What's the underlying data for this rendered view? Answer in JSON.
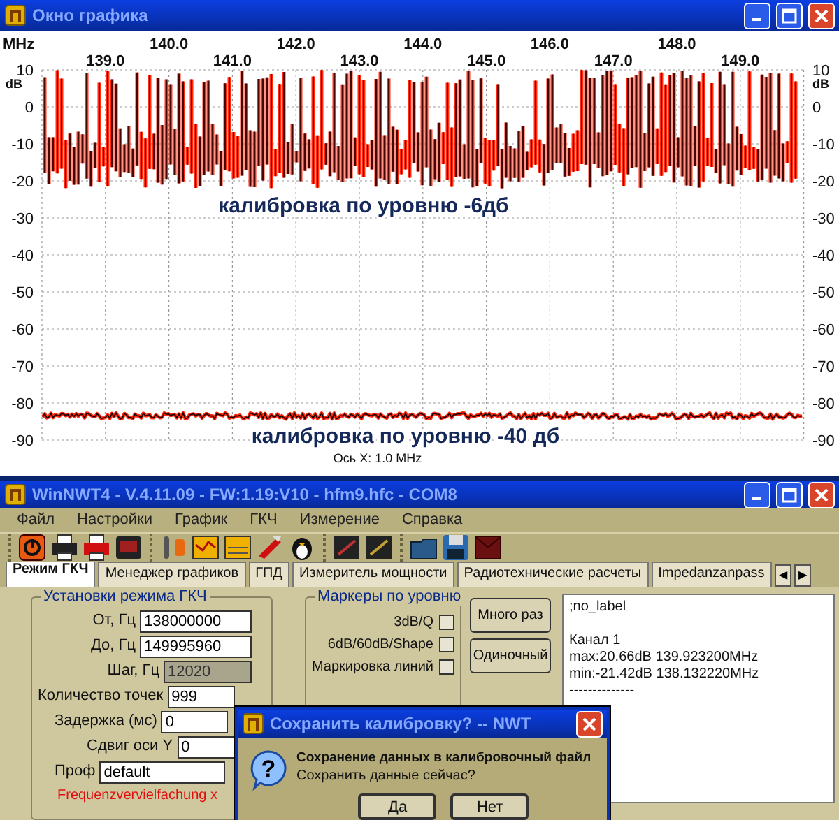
{
  "graph_window": {
    "title": "Окно графика",
    "x_axis": {
      "unit": "MHz",
      "upper_labels": [
        "140.0",
        "142.0",
        "144.0",
        "146.0",
        "148.0"
      ],
      "lower_labels": [
        "139.0",
        "141.0",
        "143.0",
        "145.0",
        "147.0",
        "149.0"
      ]
    },
    "y_axis_left": {
      "unit": "dB",
      "labels": [
        "10",
        "0",
        "-10",
        "-20",
        "-30",
        "-40",
        "-50",
        "-60",
        "-70",
        "-80",
        "-90"
      ]
    },
    "y_axis_right": {
      "unit": "dB",
      "labels": [
        "10",
        "0",
        "-10",
        "-20",
        "-30",
        "-40",
        "-50",
        "-60",
        "-70",
        "-80",
        "-90"
      ]
    },
    "annotations": [
      "калибровка по уровню -6дб",
      "калибровка по уровню -40 дб"
    ],
    "x_scale": "Ось X: 1.0 MHz"
  },
  "main_window": {
    "title": "WinNWT4 - V.4.11.09 - FW:1.19:V10 - hfm9.hfc - COM8",
    "menu": [
      "Файл",
      "Настройки",
      "График",
      "ГКЧ",
      "Измерение",
      "Справка"
    ],
    "tabs": [
      {
        "label": "Режим ГКЧ",
        "selected": true
      },
      {
        "label": "Менеджер графиков",
        "selected": false
      },
      {
        "label": "ГПД",
        "selected": false
      },
      {
        "label": "Измеритель мощности",
        "selected": false
      },
      {
        "label": "Радиотехнические расчеты",
        "selected": false
      },
      {
        "label": "Impedanzanpass",
        "selected": false
      }
    ],
    "tab_scroll_buttons": [
      "◀",
      "▶"
    ],
    "sweep_settings": {
      "title": "Установки режима ГКЧ",
      "fields": [
        {
          "label": "От, Гц",
          "value": "138000000",
          "disabled": false
        },
        {
          "label": "До, Гц",
          "value": "149995960",
          "disabled": false
        },
        {
          "label": "Шаг, Гц",
          "value": "12020",
          "disabled": true
        },
        {
          "label": "Количество точек",
          "value": "999",
          "disabled": false
        },
        {
          "label": "Задержка (мс)",
          "value": "0",
          "disabled": false
        },
        {
          "label": "Сдвиг оси Y",
          "value": "0",
          "disabled": false
        }
      ],
      "profile": {
        "label": "Проф",
        "value": "default"
      },
      "warning": "Frequenzvervielfachung x"
    },
    "markers": {
      "title": "Маркеры по уровню",
      "items": [
        {
          "label": "3dB/Q",
          "checked": false
        },
        {
          "label": "6dB/60dB/Shape",
          "checked": false
        },
        {
          "label": "Маркировка линий",
          "checked": false
        }
      ]
    },
    "buttons": [
      "Много раз",
      "Одиночный"
    ],
    "output_blocks": [
      [
        ";no_label"
      ],
      [
        "Канал 1",
        "max:20.66dB 139.923200MHz",
        "min:-21.42dB 138.132220MHz",
        "--------------"
      ]
    ]
  },
  "dialog": {
    "title": "Сохранить калибровку? -- NWT",
    "icon_text": "?",
    "message": "Сохранение данных в калибровочный файл",
    "question": "Сохранить данные сейчас?",
    "buttons": [
      "Да",
      "Нет"
    ]
  }
}
